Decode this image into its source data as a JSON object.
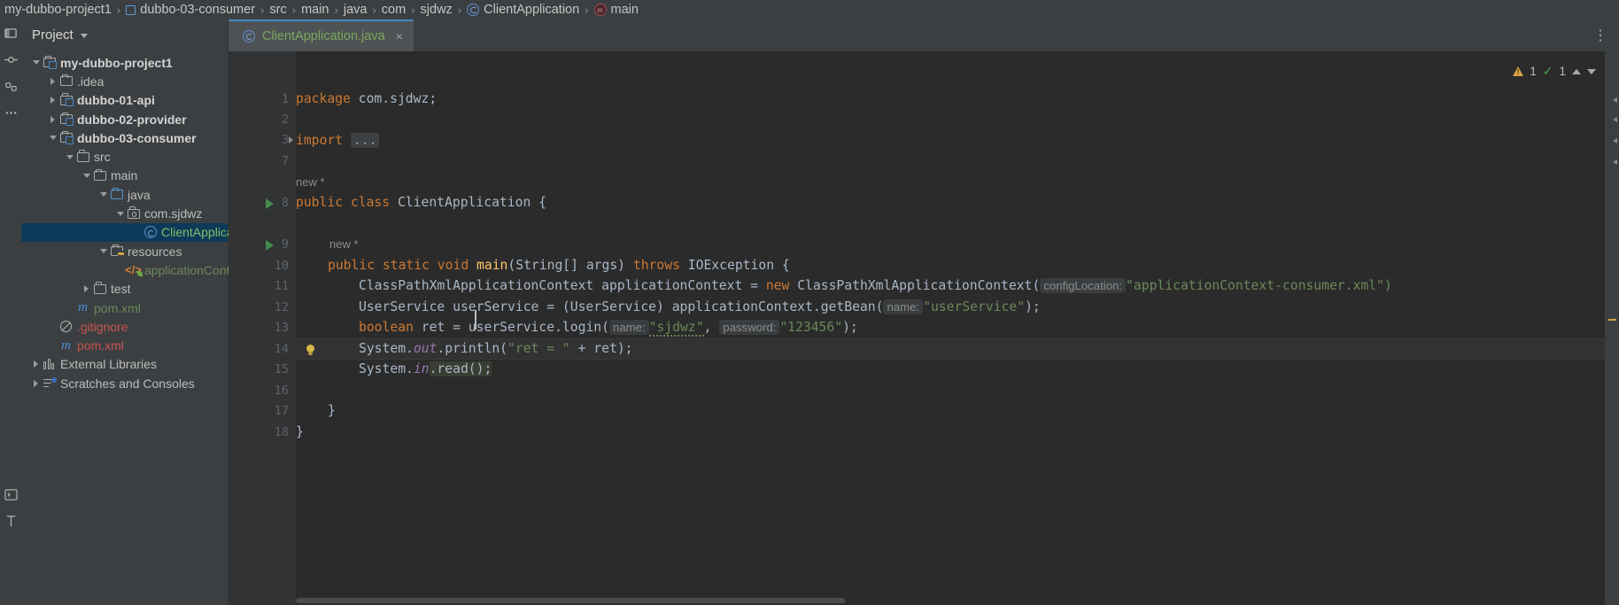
{
  "breadcrumb": {
    "items": [
      {
        "label": "my-dubbo-project1",
        "icon": "none"
      },
      {
        "label": "dubbo-03-consumer",
        "icon": "module-icon"
      },
      {
        "label": "src",
        "icon": "none"
      },
      {
        "label": "main",
        "icon": "none"
      },
      {
        "label": "java",
        "icon": "none"
      },
      {
        "label": "com",
        "icon": "none"
      },
      {
        "label": "sjdwz",
        "icon": "none"
      },
      {
        "label": "ClientApplication",
        "icon": "class-icon"
      },
      {
        "label": "main",
        "icon": "method-icon"
      }
    ],
    "separator": "›"
  },
  "project_panel": {
    "title": "Project",
    "tree": [
      {
        "label": "my-dubbo-project1",
        "icon": "module-folder-icon",
        "indent": 0,
        "twisty": "down",
        "bold": true,
        "color": "default"
      },
      {
        "label": ".idea",
        "icon": "folder-icon",
        "indent": 1,
        "twisty": "right",
        "bold": false,
        "color": "default"
      },
      {
        "label": "dubbo-01-api",
        "icon": "module-folder-icon",
        "indent": 1,
        "twisty": "right",
        "bold": true,
        "color": "default"
      },
      {
        "label": "dubbo-02-provider",
        "icon": "module-folder-icon",
        "indent": 1,
        "twisty": "right",
        "bold": true,
        "color": "default"
      },
      {
        "label": "dubbo-03-consumer",
        "icon": "module-folder-icon",
        "indent": 1,
        "twisty": "down",
        "bold": true,
        "color": "default"
      },
      {
        "label": "src",
        "icon": "folder-icon",
        "indent": 2,
        "twisty": "down",
        "bold": false,
        "color": "default"
      },
      {
        "label": "main",
        "icon": "folder-icon",
        "indent": 3,
        "twisty": "down",
        "bold": false,
        "color": "default"
      },
      {
        "label": "java",
        "icon": "source-folder-icon",
        "indent": 4,
        "twisty": "down",
        "bold": false,
        "color": "default"
      },
      {
        "label": "com.sjdwz",
        "icon": "package-icon",
        "indent": 5,
        "twisty": "down",
        "bold": false,
        "color": "default"
      },
      {
        "label": "ClientApplication",
        "icon": "java-class-icon",
        "indent": 6,
        "twisty": "none",
        "bold": false,
        "color": "green",
        "selected": true
      },
      {
        "label": "resources",
        "icon": "resources-folder-icon",
        "indent": 4,
        "twisty": "down",
        "bold": false,
        "color": "default"
      },
      {
        "label": "applicationContext-consumer.xml",
        "icon": "xml-file-icon",
        "indent": 5,
        "twisty": "none",
        "bold": false,
        "color": "green"
      },
      {
        "label": "test",
        "icon": "folder-icon",
        "indent": 3,
        "twisty": "right",
        "bold": false,
        "color": "default"
      },
      {
        "label": "pom.xml",
        "icon": "maven-icon",
        "indent": 2,
        "twisty": "none",
        "bold": false,
        "color": "green"
      },
      {
        "label": ".gitignore",
        "icon": "gitignore-icon",
        "indent": 1,
        "twisty": "none",
        "bold": false,
        "color": "red"
      },
      {
        "label": "pom.xml",
        "icon": "maven-icon",
        "indent": 1,
        "twisty": "none",
        "bold": false,
        "color": "red"
      },
      {
        "label": "External Libraries",
        "icon": "library-icon",
        "indent": 0,
        "twisty": "right",
        "bold": false,
        "color": "default"
      },
      {
        "label": "Scratches and Consoles",
        "icon": "scratches-icon",
        "indent": 0,
        "twisty": "right",
        "bold": false,
        "color": "default"
      }
    ]
  },
  "editor": {
    "tab": {
      "name": "ClientApplication.java",
      "icon": "java-class-icon",
      "close": "×"
    },
    "kebab": "⋮",
    "inspection": {
      "warning_count": "1",
      "warning_icon": "warning-triangle-icon",
      "ok_count": "1",
      "ok_icon": "check-icon",
      "prev": "▲",
      "next": "▼"
    },
    "line_numbers": [
      "1",
      "2",
      "3",
      "7",
      "8",
      "9",
      "10",
      "11",
      "12",
      "13",
      "14",
      "15",
      "16",
      "17",
      "18"
    ],
    "inlay_hints": {
      "class_new": "new *",
      "method_new": "new *"
    },
    "code": {
      "l1_kw": "package",
      "l1_rest": " com.sjdwz;",
      "l3_kw": "import",
      "l3_fold": "...",
      "l8": "public class ClientApplication {",
      "l9": "public static void main(String[] args) throws IOException {",
      "l10_a": "ClassPathXmlApplicationContext applicationContext = ",
      "l10_new": "new",
      "l10_b": " ClassPathXmlApplicationContext(",
      "l10_hint": "configLocation:",
      "l10_str": "\"applicationContext-consumer.xml\")",
      "l11_a": "UserService userService = (UserService) applicationContext.getBean(",
      "l11_hint": "name:",
      "l11_str": "\"userService\"",
      "l11_end": ");",
      "l12_kw": "boolean",
      "l12_a": " ret = userService.login(",
      "l12_hint1": "name:",
      "l12_str1": "\"sjdwz\"",
      "l12_mid": ", ",
      "l12_hint2": "password:",
      "l12_str2": "\"123456\"",
      "l12_end": ");",
      "l13_a": "System.",
      "l13_fld": "out",
      "l13_b": ".println(",
      "l13_str": "\"ret = \"",
      "l13_c": " + ret);",
      "l14_a": "System.",
      "l14_fld": "in",
      "l14_b": ".read();",
      "l16": "}",
      "l17": "}"
    }
  },
  "colors": {
    "bg_editor": "#2b2b2b",
    "bg_panel": "#3c3f41",
    "accent_tab": "#4a88c7",
    "selection": "#0d3a58",
    "keyword": "#cc7832",
    "string": "#6a8759",
    "text": "#a9b7c6",
    "hint": "#8c8c8c",
    "run_green": "#499c54",
    "warning": "#d9a343"
  }
}
